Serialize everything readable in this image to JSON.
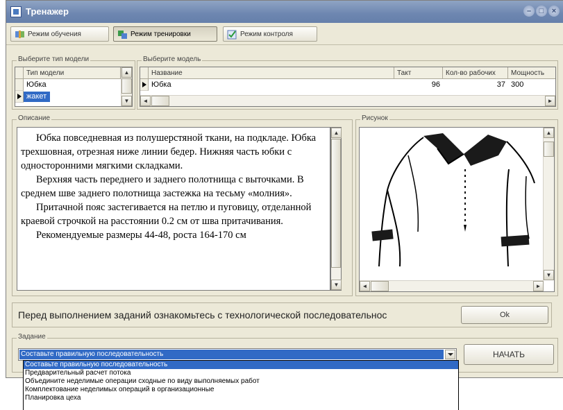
{
  "window": {
    "title": "Тренажер"
  },
  "colors": {
    "titlebar": "#6d86b0",
    "selection": "#316ac5",
    "window_bg": "#ece9d8"
  },
  "toolbar": {
    "buttons": [
      {
        "label": "Режим обучения",
        "icon": "study-icon",
        "active": false
      },
      {
        "label": "Режим тренировки",
        "icon": "training-icon",
        "active": true
      },
      {
        "label": "Режим контроля",
        "icon": "control-check-icon",
        "active": false
      }
    ]
  },
  "model_type": {
    "legend": "Выберите тип модели",
    "header": "Тип модели",
    "rows": [
      "Юбка",
      "жакет"
    ],
    "selected_index": 1
  },
  "model": {
    "legend": "Выберите модель",
    "columns": [
      "Название",
      "Такт",
      "Кол-во рабочих",
      "Мощность"
    ],
    "rows": [
      {
        "name": "Юбка",
        "takt": "96",
        "workers": "37",
        "power": "300"
      }
    ]
  },
  "description": {
    "legend": "Описание",
    "paragraphs": [
      "Юбка повседневная из полушерстяной ткани, на подкладе. Юбка трехшовная, отрезная ниже линии бедер. Нижняя часть юбки с односторонними мягкими складками.",
      "Верхняя часть переднего и заднего полотнища с выточками. В среднем шве заднего полотнища застежка на тесьму «молния».",
      "Притачной пояс застегивается на петлю и пуговицу, отделанной краевой строчкой на расстоянии 0.2 см от шва притачивания.",
      "Рекомендуемые размеры 44-48, роста 164-170 см"
    ]
  },
  "picture": {
    "legend": "Рисунок"
  },
  "notice": {
    "text": "Перед выполнением заданий ознакомьтесь с технологической последовательнос",
    "ok_label": "Ok"
  },
  "task": {
    "legend": "Задание",
    "selected": "Составьте правильную последовательность",
    "start_label": "НАЧАТЬ",
    "options": [
      "Составьте правильную последовательность",
      "Предварительный расчет потока",
      "Объедините неделимые операции сходные по виду выполняемых работ",
      "Комплектование неделимых операций в организационные",
      "Планировка цеха"
    ],
    "highlighted_index": 0
  }
}
